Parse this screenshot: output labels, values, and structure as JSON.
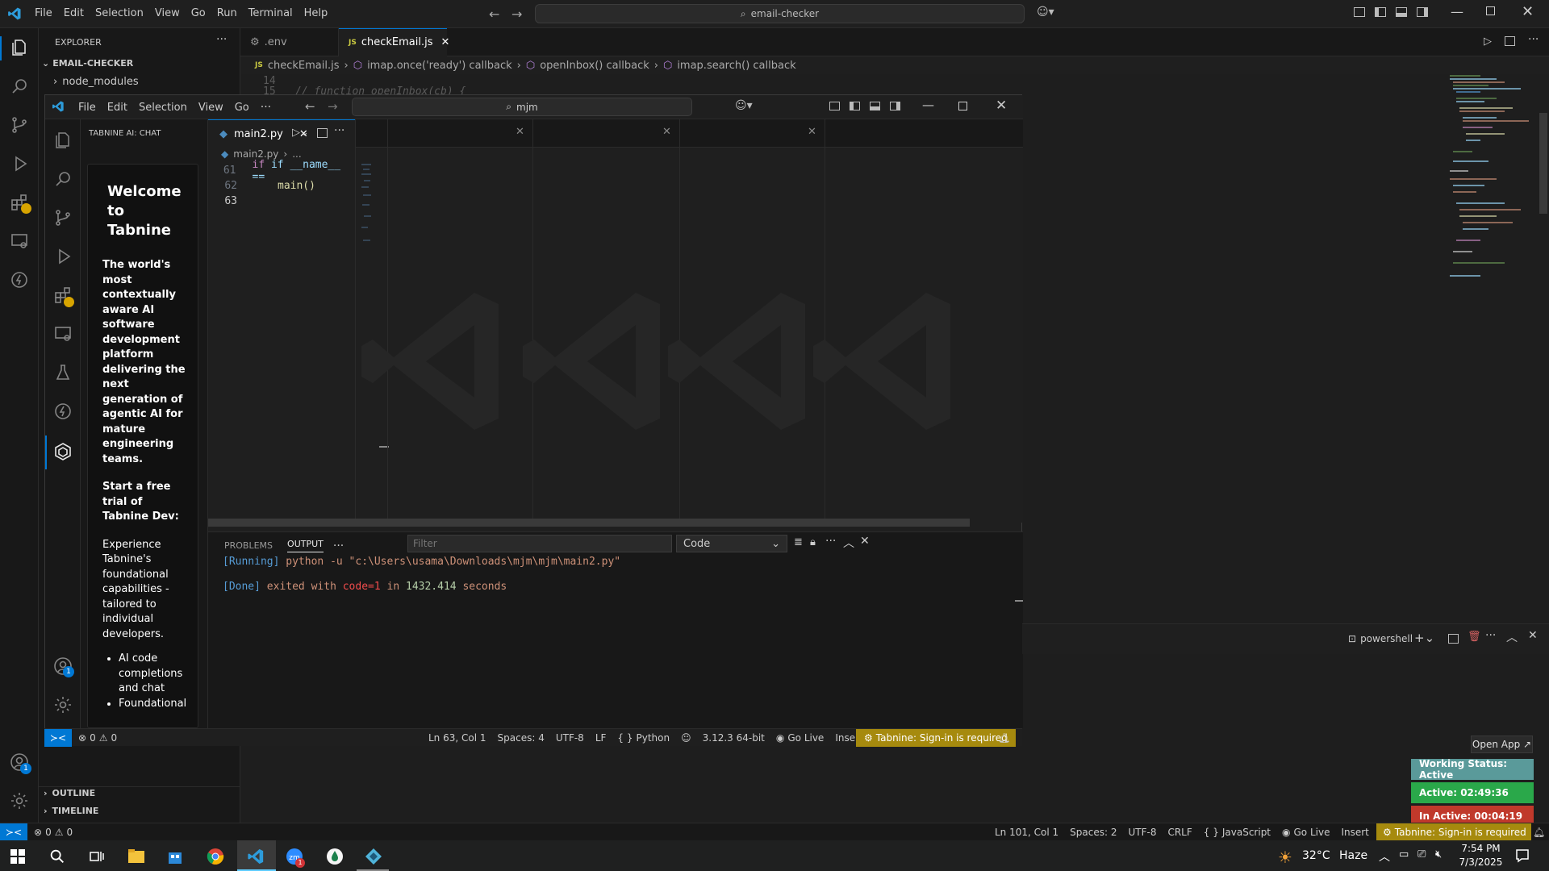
{
  "outer": {
    "menu": [
      "File",
      "Edit",
      "Selection",
      "View",
      "Go",
      "Run",
      "Terminal",
      "Help"
    ],
    "command_center": "email-checker",
    "explorer_title": "EXPLORER",
    "folder_name": "EMAIL-CHECKER",
    "tree": [
      "node_modules"
    ],
    "outline": "OUTLINE",
    "timeline": "TIMELINE",
    "tabs": [
      {
        "label": ".env",
        "icon": "gear-icon"
      },
      {
        "label": "checkEmail.js",
        "icon": "js-icon",
        "active": true
      }
    ],
    "breadcrumb": [
      "checkEmail.js",
      "imap.once('ready') callback",
      "openInbox() callback",
      "imap.search() callback"
    ],
    "editor_peek": {
      "line": "15",
      "code": "// function openInbox(cb) {",
      "prev_line": "14"
    },
    "status": {
      "errors": "0",
      "warnings": "0",
      "cursor": "Ln 101, Col 1",
      "spaces": "Spaces: 2",
      "encoding": "UTF-8",
      "eol": "CRLF",
      "language": "JavaScript",
      "golive": "Go Live",
      "mode": "Insert",
      "tabnine": "Tabnine: Sign-in is required"
    },
    "terminal": {
      "label": "powershell"
    },
    "accounts_badge": "1"
  },
  "inner": {
    "menu": [
      "File",
      "Edit",
      "Selection",
      "View",
      "Go"
    ],
    "command_center": "mjm",
    "chat_title": "TABNINE AI: CHAT",
    "chat": {
      "heading": "Welcome to Tabnine",
      "intro": "The world's most contextually aware AI software development platform delivering the next generation of agentic AI for mature engineering teams.",
      "trial": "Start a free trial of Tabnine Dev:",
      "body": "Experience Tabnine's foundational capabilities - tailored to individual developers.",
      "bullets": [
        "AI code completions and chat",
        "Foundational"
      ]
    },
    "tab": {
      "label": "main2.py"
    },
    "breadcrumb": [
      "main2.py",
      "..."
    ],
    "code": [
      {
        "num": "61",
        "text": "if __name__ =="
      },
      {
        "num": "62",
        "text": "main()"
      },
      {
        "num": "63",
        "text": ""
      }
    ],
    "panel": {
      "tabs": [
        "PROBLEMS",
        "OUTPUT"
      ],
      "filter_placeholder": "Filter",
      "channel": "Code",
      "running_tag": "[Running]",
      "running_cmd": "python -u \"c:\\Users\\usama\\Downloads\\mjm\\mjm\\main2.py\"",
      "done_tag": "[Done]",
      "done_a": "exited with",
      "done_code": "code=1",
      "done_b": "in",
      "done_time": "1432.414",
      "done_c": "seconds"
    },
    "status": {
      "errors": "0",
      "warnings": "0",
      "cursor": "Ln 63, Col 1",
      "spaces": "Spaces: 4",
      "encoding": "UTF-8",
      "eol": "LF",
      "language": "Python",
      "interpreter": "3.12.3 64-bit",
      "golive": "Go Live",
      "mode": "Insert",
      "tabnine": "Tabnine: Sign-in is required"
    },
    "accounts_badge": "1"
  },
  "widget": {
    "open_app": "Open App ↗",
    "working": "Working Status: Active",
    "active": "Active: 02:49:36",
    "inactive": "In Active: 00:04:19",
    "colors": {
      "working": "#5a9a9a",
      "active": "#2aa84a",
      "inactive": "#c0392b"
    }
  },
  "taskbar": {
    "weather_temp": "32°C",
    "weather_text": "Haze",
    "time": "7:54 PM",
    "date": "7/3/2025",
    "zoom_badge": "1"
  },
  "colors": {
    "tabnine_status": "#a68a0e",
    "vscode_blue": "#0078d4"
  }
}
